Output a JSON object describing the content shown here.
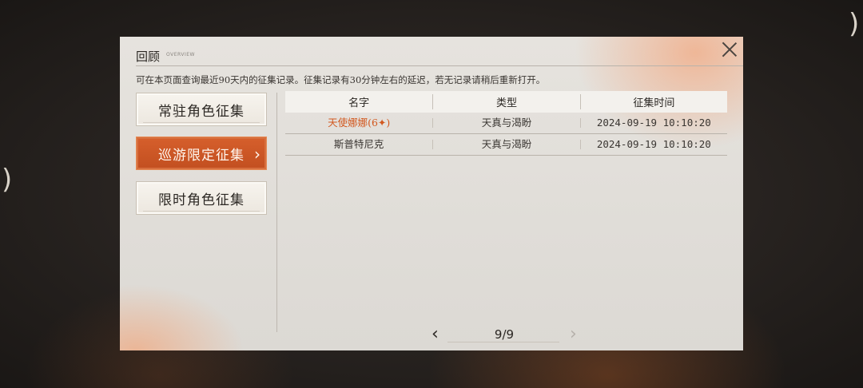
{
  "panel": {
    "title": "回顾",
    "title_sub": "OVERVIEW",
    "notice": "可在本页面查询最近90天内的征集记录。征集记录有30分钟左右的延迟，若无记录请稍后重新打开。"
  },
  "sidebar": {
    "items": [
      {
        "label": "常驻角色征集",
        "active": false
      },
      {
        "label": "巡游限定征集",
        "active": true
      },
      {
        "label": "限时角色征集",
        "active": false
      }
    ]
  },
  "table": {
    "headers": [
      "名字",
      "类型",
      "征集时间"
    ],
    "rows": [
      {
        "name": "天使娜娜(6✦)",
        "type": "天真与渴盼",
        "time": "2024-09-19 10:10:20",
        "highlight": true
      },
      {
        "name": "斯普特尼克",
        "type": "天真与渴盼",
        "time": "2024-09-19 10:10:20",
        "highlight": false
      }
    ]
  },
  "pager": {
    "text": "9/9",
    "prev_icon": "chevron-left-icon",
    "next_icon": "chevron-right-icon"
  },
  "colors": {
    "accent": "#c95524",
    "highlight_text": "#d2581f"
  }
}
